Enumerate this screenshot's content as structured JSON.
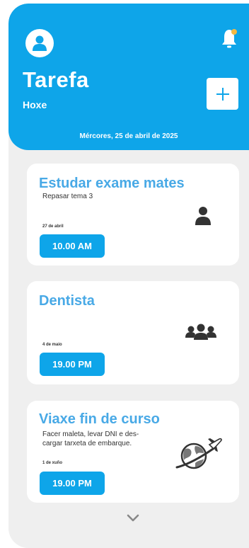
{
  "header": {
    "title": "Tarefa",
    "subtitle": "Hoxe",
    "date": "Mércores, 25 de abril de 2025",
    "accent_color": "#0ea5e9",
    "notification_dot_color": "#f4b942"
  },
  "tasks": [
    {
      "title": "Estudar exame mates",
      "description": "Repasar tema 3",
      "day": "27 de abril",
      "time": "10.00 AM",
      "icon": "person-icon"
    },
    {
      "title": "Dentista",
      "description": "",
      "day": "4 de maio",
      "time": "19.00 PM",
      "icon": "group-icon"
    },
    {
      "title": "Viaxe fin de curso",
      "description": "Facer maleta, levar DNI e des-cargar tarxeta de embarque.",
      "day": "1 de xuño",
      "time": "19.00 PM",
      "icon": "travel-globe-icon"
    }
  ]
}
